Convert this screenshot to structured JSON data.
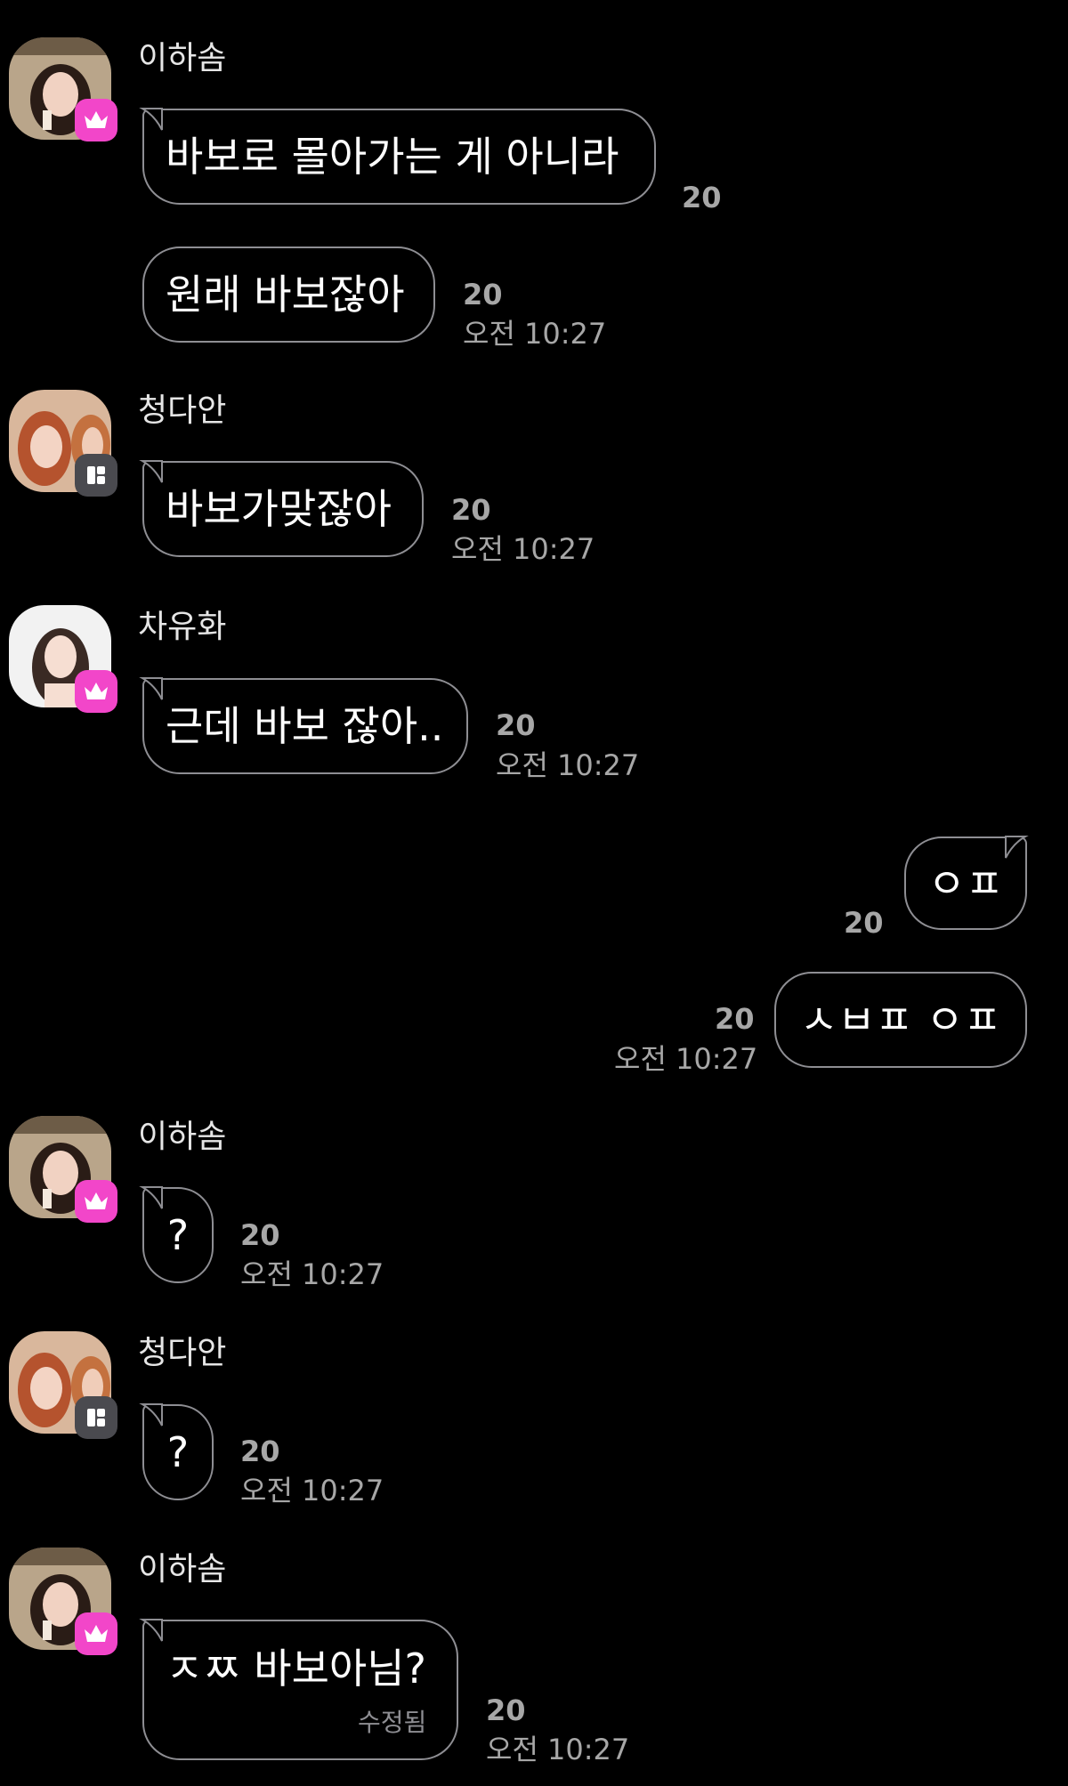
{
  "colors": {
    "background": "#000000",
    "bubble_border": "#8e8e93",
    "meta_text": "#a7a7a7",
    "crown_badge": "#f246c9",
    "block_badge": "#4a4a4f"
  },
  "messages": [
    {
      "sender": "이하솜",
      "badge_icon": "crown-icon",
      "bubbles": [
        {
          "text": "바보로 몰아가는 게 아니라",
          "count": "20"
        },
        {
          "text": "원래 바보잖아",
          "count": "20",
          "time": "오전 10:27"
        }
      ]
    },
    {
      "sender": "청다안",
      "badge_icon": "block-icon",
      "bubbles": [
        {
          "text": "바보가맞잖아",
          "count": "20",
          "time": "오전 10:27"
        }
      ]
    },
    {
      "sender": "차유화",
      "badge_icon": "crown-icon",
      "bubbles": [
        {
          "text": "근데 바보 잖아..",
          "count": "20",
          "time": "오전 10:27"
        }
      ]
    },
    {
      "sender": "",
      "outgoing": true,
      "bubbles": [
        {
          "text": "ㅇㅍ",
          "count": "20"
        },
        {
          "text": "ㅅㅂㅍ ㅇㅍ",
          "count": "20",
          "time": "오전 10:27"
        }
      ]
    },
    {
      "sender": "이하솜",
      "badge_icon": "crown-icon",
      "bubbles": [
        {
          "text": "?",
          "count": "20",
          "time": "오전 10:27"
        }
      ]
    },
    {
      "sender": "청다안",
      "badge_icon": "block-icon",
      "bubbles": [
        {
          "text": "?",
          "count": "20",
          "time": "오전 10:27"
        }
      ]
    },
    {
      "sender": "이하솜",
      "badge_icon": "crown-icon",
      "bubbles": [
        {
          "text": "ㅈㅉ 바보아님?",
          "edited": "수정됨",
          "count": "20",
          "time": "오전 10:27"
        }
      ]
    }
  ]
}
